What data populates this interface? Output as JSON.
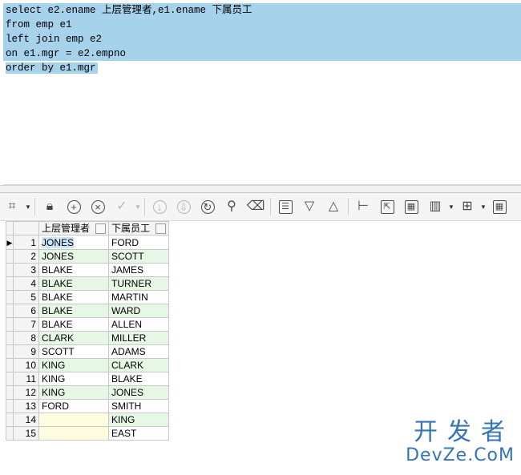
{
  "editor": {
    "lines": [
      "select e2.ename 上层管理者,e1.ename 下属员工",
      "from emp e1",
      "left join emp e2",
      "on e1.mgr = e2.empno",
      "order by e1.mgr"
    ]
  },
  "grid": {
    "headers": [
      "上层管理者",
      "下属员工"
    ],
    "rows": [
      {
        "n": "1",
        "mgr": "JONES",
        "emp": "FORD"
      },
      {
        "n": "2",
        "mgr": "JONES",
        "emp": "SCOTT"
      },
      {
        "n": "3",
        "mgr": "BLAKE",
        "emp": "JAMES"
      },
      {
        "n": "4",
        "mgr": "BLAKE",
        "emp": "TURNER"
      },
      {
        "n": "5",
        "mgr": "BLAKE",
        "emp": "MARTIN"
      },
      {
        "n": "6",
        "mgr": "BLAKE",
        "emp": "WARD"
      },
      {
        "n": "7",
        "mgr": "BLAKE",
        "emp": "ALLEN"
      },
      {
        "n": "8",
        "mgr": "CLARK",
        "emp": "MILLER"
      },
      {
        "n": "9",
        "mgr": "SCOTT",
        "emp": "ADAMS"
      },
      {
        "n": "10",
        "mgr": "KING",
        "emp": "CLARK"
      },
      {
        "n": "11",
        "mgr": "KING",
        "emp": "BLAKE"
      },
      {
        "n": "12",
        "mgr": "KING",
        "emp": "JONES"
      },
      {
        "n": "13",
        "mgr": "FORD",
        "emp": "SMITH"
      },
      {
        "n": "14",
        "mgr": "",
        "emp": "KING"
      },
      {
        "n": "15",
        "mgr": "",
        "emp": "EAST"
      }
    ]
  },
  "watermark": {
    "cn": "开发者",
    "en": "DevZe.CoM"
  },
  "colors": {
    "selection": "#a6d2ec",
    "alt_row": "#e6f7e6",
    "null_cell": "#fffde0",
    "watermark": "#2b6db3"
  }
}
